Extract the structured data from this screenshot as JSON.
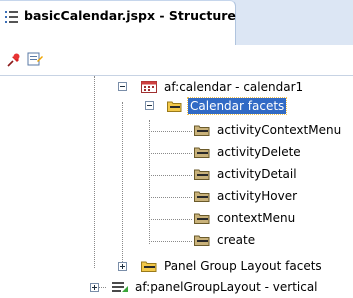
{
  "panel": {
    "title": "basicCalendar.jspx - Structure",
    "title_icon": "structure-list-icon"
  },
  "toolbar": {
    "pin_icon": "pin-icon",
    "properties_icon": "properties-icon"
  },
  "tree": {
    "nodes": [
      {
        "label": "af:calendar - calendar1",
        "icon": "calendar-icon",
        "expanded": true
      },
      {
        "label": "Calendar facets",
        "icon": "folder-open-icon",
        "expanded": true,
        "selected": true
      },
      {
        "label": "activityContextMenu",
        "icon": "facet-folder-icon"
      },
      {
        "label": "activityDelete",
        "icon": "facet-folder-icon"
      },
      {
        "label": "activityDetail",
        "icon": "facet-folder-icon"
      },
      {
        "label": "activityHover",
        "icon": "facet-folder-icon"
      },
      {
        "label": "contextMenu",
        "icon": "facet-folder-icon"
      },
      {
        "label": "create",
        "icon": "facet-folder-icon"
      },
      {
        "label": "Panel Group Layout facets",
        "icon": "folder-icon",
        "expanded": false
      },
      {
        "label": "af:panelGroupLayout - vertical",
        "icon": "panel-group-layout-icon",
        "expanded": false
      }
    ]
  },
  "colors": {
    "header_bg": "#dce6f4",
    "selection": "#316ac5",
    "folder": "#f3c94a"
  }
}
